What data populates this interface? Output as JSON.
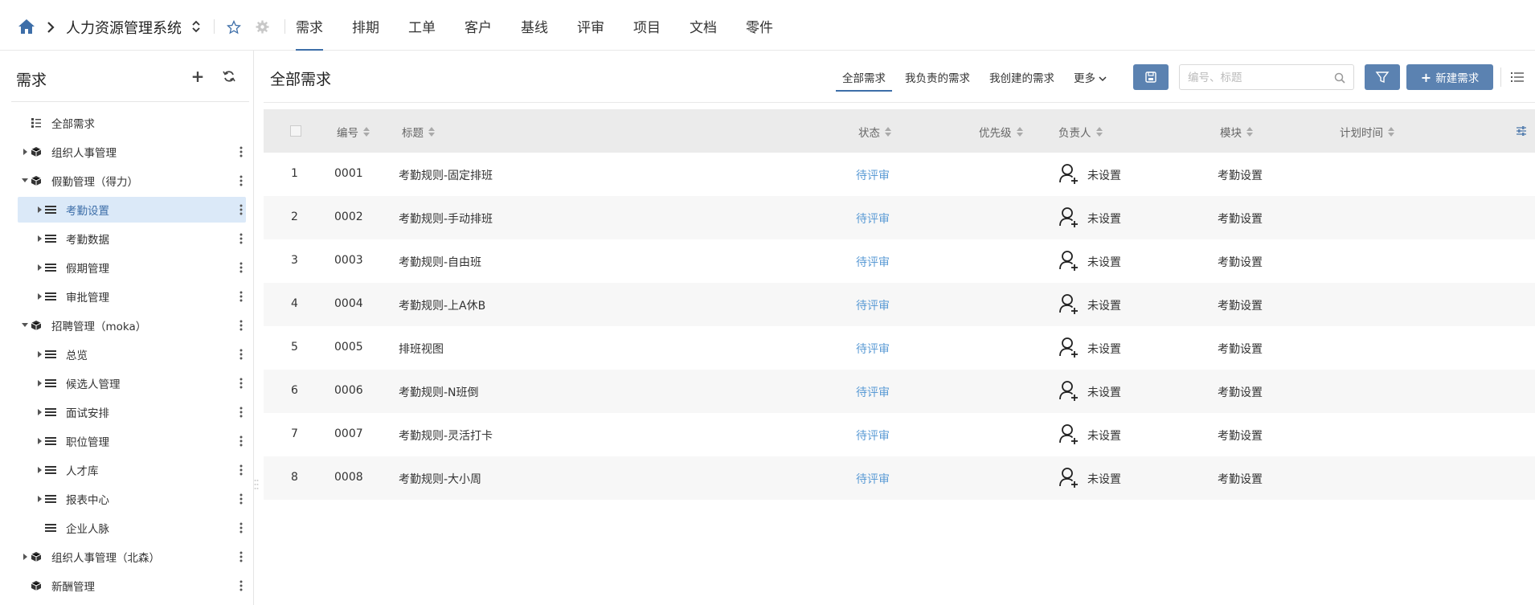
{
  "topbar": {
    "project_name": "人力资源管理系统",
    "nav_tabs": [
      "需求",
      "排期",
      "工单",
      "客户",
      "基线",
      "评审",
      "项目",
      "文档",
      "零件"
    ]
  },
  "sidebar": {
    "title": "需求",
    "tree": [
      {
        "label": "全部需求",
        "level": 0,
        "icon": "list-tree-icon",
        "arrow": "none",
        "more": false
      },
      {
        "label": "组织人事管理",
        "level": 0,
        "icon": "cube-icon",
        "arrow": "right",
        "more": true
      },
      {
        "label": "假勤管理（得力）",
        "level": 0,
        "icon": "cube-icon",
        "arrow": "down",
        "more": true
      },
      {
        "label": "考勤设置",
        "level": 1,
        "icon": "list-icon",
        "arrow": "right",
        "more": true,
        "selected": true
      },
      {
        "label": "考勤数据",
        "level": 1,
        "icon": "list-icon",
        "arrow": "right",
        "more": true
      },
      {
        "label": "假期管理",
        "level": 1,
        "icon": "list-icon",
        "arrow": "right",
        "more": true
      },
      {
        "label": "审批管理",
        "level": 1,
        "icon": "list-icon",
        "arrow": "right",
        "more": true
      },
      {
        "label": "招聘管理（moka）",
        "level": 0,
        "icon": "cube-icon",
        "arrow": "down",
        "more": true
      },
      {
        "label": "总览",
        "level": 1,
        "icon": "list-icon",
        "arrow": "right",
        "more": true
      },
      {
        "label": "候选人管理",
        "level": 1,
        "icon": "list-icon",
        "arrow": "right",
        "more": true
      },
      {
        "label": "面试安排",
        "level": 1,
        "icon": "list-icon",
        "arrow": "right",
        "more": true
      },
      {
        "label": "职位管理",
        "level": 1,
        "icon": "list-icon",
        "arrow": "right",
        "more": true
      },
      {
        "label": "人才库",
        "level": 1,
        "icon": "list-icon",
        "arrow": "right",
        "more": true
      },
      {
        "label": "报表中心",
        "level": 1,
        "icon": "list-icon",
        "arrow": "right",
        "more": true
      },
      {
        "label": "企业人脉",
        "level": 1,
        "icon": "list-icon",
        "arrow": "none",
        "more": true
      },
      {
        "label": "组织人事管理（北森）",
        "level": 0,
        "icon": "cube-icon",
        "arrow": "right",
        "more": true
      },
      {
        "label": "新酬管理",
        "level": 0,
        "icon": "cube-icon",
        "arrow": "none",
        "more": true
      }
    ]
  },
  "main": {
    "title": "全部需求",
    "filter_tabs": [
      "全部需求",
      "我负责的需求",
      "我创建的需求",
      "更多"
    ],
    "search_placeholder": "编号、标题",
    "new_button_label": "新建需求",
    "columns": [
      "编号",
      "标题",
      "状态",
      "优先级",
      "负责人",
      "模块",
      "计划时间"
    ],
    "rows": [
      {
        "index": "1",
        "id": "0001",
        "title": "考勤规则-固定排班",
        "status": "待评审",
        "owner": "未设置",
        "module": "考勤设置"
      },
      {
        "index": "2",
        "id": "0002",
        "title": "考勤规则-手动排班",
        "status": "待评审",
        "owner": "未设置",
        "module": "考勤设置"
      },
      {
        "index": "3",
        "id": "0003",
        "title": "考勤规则-自由班",
        "status": "待评审",
        "owner": "未设置",
        "module": "考勤设置"
      },
      {
        "index": "4",
        "id": "0004",
        "title": "考勤规则-上A休B",
        "status": "待评审",
        "owner": "未设置",
        "module": "考勤设置"
      },
      {
        "index": "5",
        "id": "0005",
        "title": "排班视图",
        "status": "待评审",
        "owner": "未设置",
        "module": "考勤设置"
      },
      {
        "index": "6",
        "id": "0006",
        "title": "考勤规则-N班倒",
        "status": "待评审",
        "owner": "未设置",
        "module": "考勤设置"
      },
      {
        "index": "7",
        "id": "0007",
        "title": "考勤规则-灵活打卡",
        "status": "待评审",
        "owner": "未设置",
        "module": "考勤设置"
      },
      {
        "index": "8",
        "id": "0008",
        "title": "考勤规则-大小周",
        "status": "待评审",
        "owner": "未设置",
        "module": "考勤设置"
      }
    ]
  },
  "colors": {
    "accent": "#3d6ea8",
    "button": "#5b82b1",
    "status": "#5b9bd5",
    "selected_bg": "#dbe9f8",
    "table_header_bg": "#ebebeb"
  }
}
